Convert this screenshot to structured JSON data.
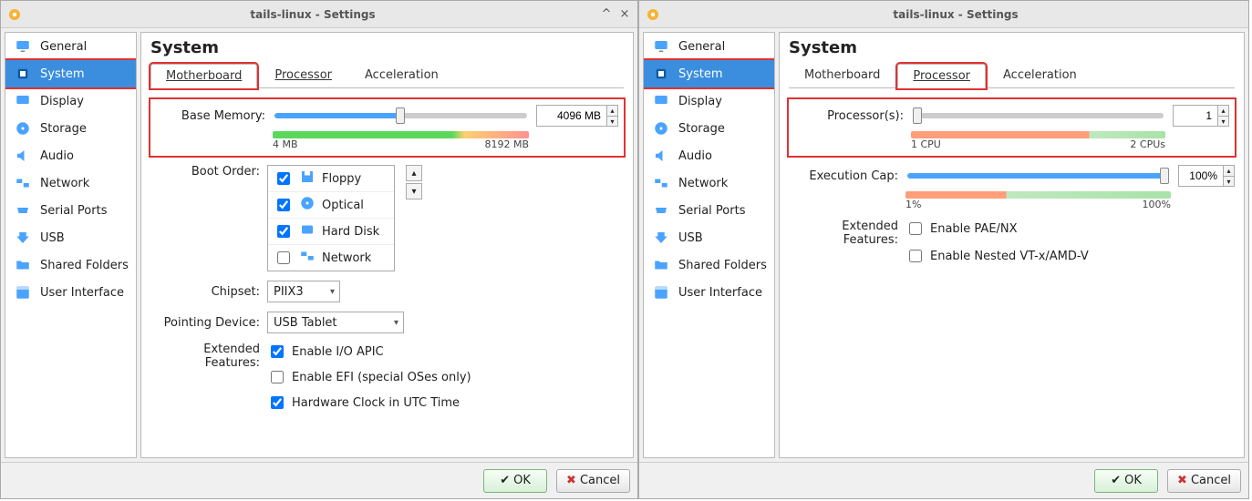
{
  "titlebar": {
    "title": "tails-linux - Settings"
  },
  "common": {
    "sidebar": [
      {
        "key": "general",
        "label": "General"
      },
      {
        "key": "system",
        "label": "System"
      },
      {
        "key": "display",
        "label": "Display"
      },
      {
        "key": "storage",
        "label": "Storage"
      },
      {
        "key": "audio",
        "label": "Audio"
      },
      {
        "key": "network",
        "label": "Network"
      },
      {
        "key": "serial-ports",
        "label": "Serial Ports"
      },
      {
        "key": "usb",
        "label": "USB"
      },
      {
        "key": "shared-folders",
        "label": "Shared Folders"
      },
      {
        "key": "user-interface",
        "label": "User Interface"
      }
    ],
    "tabs": {
      "motherboard": "Motherboard",
      "processor": "Processor",
      "acceleration": "Acceleration"
    },
    "heading": "System",
    "buttons": {
      "ok": "OK",
      "cancel": "Cancel"
    }
  },
  "left": {
    "activeTab": "motherboard",
    "motherboard": {
      "labels": {
        "baseMemory": "Base Memory:",
        "bootOrder": "Boot Order:",
        "chipset": "Chipset:",
        "pointingDevice": "Pointing Device:",
        "extendedFeatures": "Extended Features:"
      },
      "baseMemory": {
        "value": "4096 MB",
        "min": "4 MB",
        "max": "8192 MB"
      },
      "bootItems": [
        {
          "label": "Floppy",
          "checked": true
        },
        {
          "label": "Optical",
          "checked": true
        },
        {
          "label": "Hard Disk",
          "checked": true
        },
        {
          "label": "Network",
          "checked": false
        }
      ],
      "chipset": "PIIX3",
      "pointingDevice": "USB Tablet",
      "features": {
        "ioApic": {
          "label": "Enable I/O APIC",
          "checked": true
        },
        "efi": {
          "label": "Enable EFI (special OSes only)",
          "checked": false
        },
        "utcClock": {
          "label": "Hardware Clock in UTC Time",
          "checked": true
        }
      }
    }
  },
  "right": {
    "activeTab": "processor",
    "processor": {
      "labels": {
        "processors": "Processor(s):",
        "executionCap": "Execution Cap:",
        "extendedFeatures": "Extended Features:"
      },
      "processors": {
        "value": "1",
        "min": "1 CPU",
        "max": "2 CPUs"
      },
      "executionCap": {
        "value": "100%",
        "min": "1%",
        "max": "100%"
      },
      "features": {
        "paenx": {
          "label": "Enable PAE/NX",
          "checked": false
        },
        "nested": {
          "label": "Enable Nested VT-x/AMD-V",
          "checked": false
        }
      }
    }
  }
}
